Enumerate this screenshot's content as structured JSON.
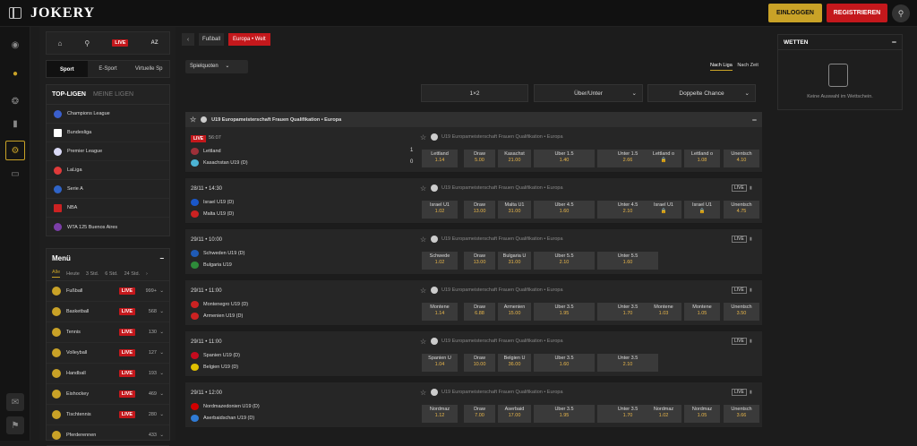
{
  "header": {
    "logo": "JOKERY",
    "login": "EINLOGGEN",
    "register": "REGISTRIEREN"
  },
  "left": {
    "live": "LIVE",
    "az": "AZ",
    "tabs": [
      "Sport",
      "E-Sport",
      "Virtuelle Sp"
    ],
    "top_leagues": "TOP-LIGEN",
    "my_leagues": "MEINE LIGEN",
    "leagues": [
      "Champions League",
      "Bundesliga",
      "Premier League",
      "LaLiga",
      "Serie A",
      "NBA",
      "WTA 125 Buenos Aires"
    ],
    "menu": "Menü",
    "filters": [
      "Alle",
      "Heute",
      "3 Std.",
      "6 Std.",
      "24 Std."
    ],
    "sports": [
      {
        "name": "Fußball",
        "count": "999+"
      },
      {
        "name": "Basketball",
        "count": "568"
      },
      {
        "name": "Tennis",
        "count": "130"
      },
      {
        "name": "Volleyball",
        "count": "127"
      },
      {
        "name": "Handball",
        "count": "193"
      },
      {
        "name": "Eishockey",
        "count": "469"
      },
      {
        "name": "Tischtennis",
        "count": "280"
      },
      {
        "name": "Pferderennen",
        "count": "433"
      }
    ]
  },
  "center": {
    "crumb1": "Fußball",
    "crumb2": "Europa • Welt",
    "spielquoten": "Spielquoten",
    "sort_by_league": "Nach Liga",
    "sort_by_time": "Nach Zeit",
    "markets": [
      "1×2",
      "Über/Unter",
      "Doppelte Chance"
    ],
    "competition": "U19 Europameisterschaft Frauen Qualifikation • Europa",
    "live_label": "LIVE",
    "matches": [
      {
        "time": "",
        "live": "LIVE",
        "livetime": "56:07",
        "home": "Lettland",
        "away": "Kasachstan U19 (D)",
        "score_home": "1",
        "score_away": "0",
        "odds": [
          [
            "Lettland",
            "1.14"
          ],
          [
            "Draw",
            "5.00"
          ],
          [
            "Kasachst",
            "21.00"
          ],
          [
            "Über 1.5",
            "1.40"
          ],
          [
            "Unter 1.5",
            "2.66"
          ],
          [
            "Lettland o",
            ""
          ],
          [
            "Lettland o",
            "1.08"
          ],
          [
            "Unentsch",
            "4.10"
          ]
        ]
      },
      {
        "time": "28/11 • 14:30",
        "home": "Israel U19 (D)",
        "away": "Malta U19 (D)",
        "odds": [
          [
            "Israel U1",
            "1.02"
          ],
          [
            "Draw",
            "13.00"
          ],
          [
            "Malta U1",
            "31.00"
          ],
          [
            "Über 4.5",
            "1.60"
          ],
          [
            "Unter 4.5",
            "2.10"
          ],
          [
            "Israel U1",
            ""
          ],
          [
            "Israel U1",
            ""
          ],
          [
            "Unentsch",
            "4.75"
          ]
        ]
      },
      {
        "time": "29/11 • 10:00",
        "home": "Schweden U19 (D)",
        "away": "Bulgaria U19",
        "odds": [
          [
            "Schwede",
            "1.02"
          ],
          [
            "Draw",
            "13.00"
          ],
          [
            "Bulgaria U",
            "31.00"
          ],
          [
            "Über 5.5",
            "2.10"
          ],
          [
            "Unter 5.5",
            "1.60"
          ]
        ]
      },
      {
        "time": "29/11 • 11:00",
        "home": "Montenegro U19 (D)",
        "away": "Armenien U19 (D)",
        "odds": [
          [
            "Montene",
            "1.14"
          ],
          [
            "Draw",
            "6.88"
          ],
          [
            "Armenien",
            "15.00"
          ],
          [
            "Über 3.5",
            "1.95"
          ],
          [
            "Unter 3.5",
            "1.70"
          ],
          [
            "Montene",
            "1.03"
          ],
          [
            "Montene",
            "1.05"
          ],
          [
            "Unentsch",
            "3.50"
          ]
        ]
      },
      {
        "time": "29/11 • 11:00",
        "home": "Spanien U19 (D)",
        "away": "Belgien U19 (D)",
        "odds": [
          [
            "Spanien U",
            "1.04"
          ],
          [
            "Draw",
            "10.00"
          ],
          [
            "Belgien U",
            "36.00"
          ],
          [
            "Über 3.5",
            "1.60"
          ],
          [
            "Unter 3.5",
            "2.10"
          ]
        ]
      },
      {
        "time": "29/11 • 12:00",
        "home": "Nordmazedonien U19 (D)",
        "away": "Aserbaidschan U19 (D)",
        "odds": [
          [
            "Nordmaz",
            "1.12"
          ],
          [
            "Draw",
            "7.00"
          ],
          [
            "Aserbaid",
            "17.00"
          ],
          [
            "Über 3.5",
            "1.95"
          ],
          [
            "Unter 3.5",
            "1.70"
          ],
          [
            "Nordmaz",
            "1.02"
          ],
          [
            "Nordmaz",
            "1.05"
          ],
          [
            "Unentsch",
            "3.66"
          ]
        ]
      }
    ]
  },
  "right": {
    "title": "WETTEN",
    "empty": "Keine Auswahl im Wettschein."
  }
}
